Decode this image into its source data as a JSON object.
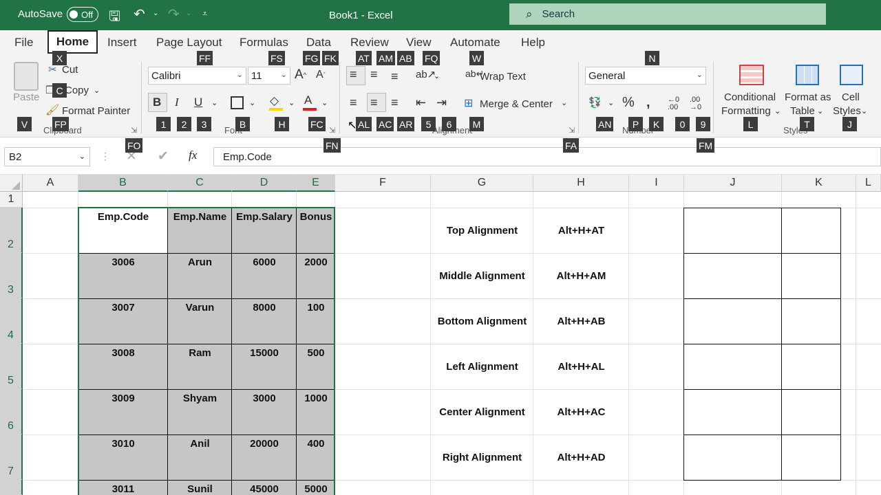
{
  "titlebar": {
    "autosave_label": "AutoSave",
    "autosave_state": "Off",
    "title": "Book1  -  Excel",
    "search_placeholder": "Search"
  },
  "tabs": [
    "File",
    "Home",
    "Insert",
    "Page Layout",
    "Formulas",
    "Data",
    "Review",
    "View",
    "Automate",
    "Help"
  ],
  "ribbon": {
    "clipboard": {
      "paste": "Paste",
      "cut": "Cut",
      "copy": "Copy",
      "format_painter": "Format Painter",
      "group": "Clipboard"
    },
    "font": {
      "name": "Calibri",
      "size": "11",
      "group": "Font"
    },
    "alignment": {
      "wrap_text": "Wrap Text",
      "merge_center": "Merge & Center",
      "group": "Alignment"
    },
    "number": {
      "format": "General",
      "group": "Number"
    },
    "styles": {
      "cond1": "Conditional",
      "cond2": "Formatting",
      "fmt1": "Format as",
      "fmt2": "Table",
      "cell1": "Cell",
      "cell2": "Styles",
      "group": "Styles"
    }
  },
  "keytips": {
    "X": "X",
    "C": "C",
    "V": "V",
    "FP": "FP",
    "FO": "FO",
    "FF": "FF",
    "FS": "FS",
    "FG": "FG",
    "FK": "FK",
    "AT": "AT",
    "AM": "AM",
    "AB": "AB",
    "FQ": "FQ",
    "W": "W",
    "N": "N",
    "k1": "1",
    "k2": "2",
    "k3": "3",
    "B": "B",
    "H": "H",
    "FC": "FC",
    "FN": "FN",
    "AL": "AL",
    "AC": "AC",
    "AR": "AR",
    "k5": "5",
    "k6": "6",
    "M": "M",
    "FA": "FA",
    "AN": "AN",
    "P": "P",
    "K": "K",
    "k0": "0",
    "k9": "9",
    "FM": "FM",
    "L": "L",
    "T": "T",
    "J": "J"
  },
  "formula_bar": {
    "name_box": "B2",
    "formula": "Emp.Code",
    "fx": "fx"
  },
  "columns": [
    "A",
    "B",
    "C",
    "D",
    "E",
    "F",
    "G",
    "H",
    "I",
    "J",
    "K",
    "L"
  ],
  "rows": [
    "1",
    "2",
    "3",
    "4",
    "5",
    "6",
    "7"
  ],
  "table": {
    "headers": [
      "Emp.Code",
      "Emp.Name",
      "Emp.Salary",
      "Bonus"
    ],
    "rows": [
      [
        "3006",
        "Arun",
        "6000",
        "2000"
      ],
      [
        "3007",
        "Varun",
        "8000",
        "100"
      ],
      [
        "3008",
        "Ram",
        "15000",
        "500"
      ],
      [
        "3009",
        "Shyam",
        "3000",
        "1000"
      ],
      [
        "3010",
        "Anil",
        "20000",
        "400"
      ],
      [
        "3011",
        "Sunil",
        "45000",
        "5000"
      ]
    ]
  },
  "shortcuts": [
    [
      "Top Alignment",
      "Alt+H+AT"
    ],
    [
      "Middle Alignment",
      "Alt+H+AM"
    ],
    [
      "Bottom Alignment",
      "Alt+H+AB"
    ],
    [
      "Left Alignment",
      "Alt+H+AL"
    ],
    [
      "Center Alignment",
      "Alt+H+AC"
    ],
    [
      "Right Alignment",
      "Alt+H+AD"
    ]
  ],
  "colors": {
    "excel_green": "#217346",
    "cell_shade": "#c6c6c6"
  }
}
